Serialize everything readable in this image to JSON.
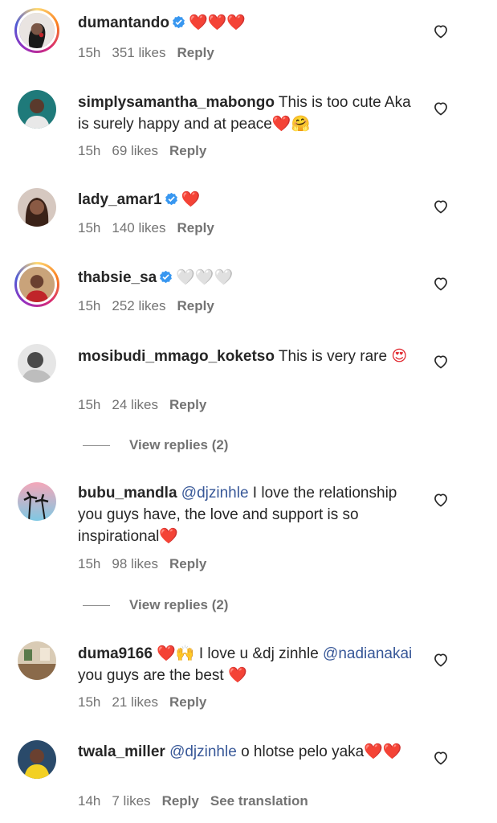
{
  "comments": [
    {
      "username": "dumantando",
      "verified": true,
      "text": "",
      "emoji": "❤️❤️❤️",
      "time": "15h",
      "likes": "351 likes",
      "reply": "Reply",
      "avatar": "dark-portrait"
    },
    {
      "username": "simplysamantha_mabongo",
      "verified": false,
      "text": "This is too cute Aka is surely happy and at peace",
      "emoji": "❤️🤗",
      "time": "15h",
      "likes": "69 likes",
      "reply": "Reply",
      "avatar": "teal-portrait"
    },
    {
      "username": "lady_amar1",
      "verified": true,
      "text": "",
      "emoji": "❤️",
      "time": "15h",
      "likes": "140 likes",
      "reply": "Reply",
      "avatar": "brown-portrait"
    },
    {
      "username": "thabsie_sa",
      "verified": true,
      "text": "",
      "emoji": "🤍🤍🤍",
      "time": "15h",
      "likes": "252 likes",
      "reply": "Reply",
      "avatar": "red-portrait"
    },
    {
      "username": "mosibudi_mmago_koketso",
      "verified": false,
      "text": "This is very rare",
      "emoji": "😍",
      "time": "15h",
      "likes": "24 likes",
      "reply": "Reply",
      "avatar": "gray-portrait"
    },
    {
      "username": "bubu_mandla",
      "verified": false,
      "mention": "@djzinhle",
      "text": "I love the relationship you guys have, the love and support is so inspirational",
      "emoji": "❤️",
      "time": "15h",
      "likes": "98 likes",
      "reply": "Reply",
      "avatar": "palm-sunset"
    },
    {
      "username": "duma9166",
      "verified": false,
      "emoji_lead": "❤️🙌",
      "text": "I love u &dj zinhle",
      "mention": "@nadianakai",
      "text2": "you guys are the best",
      "emoji": "❤️",
      "time": "15h",
      "likes": "21 likes",
      "reply": "Reply",
      "avatar": "room-photo"
    },
    {
      "username": "twala_miller",
      "verified": false,
      "mention": "@djzinhle",
      "text": "o hlotse pelo yaka",
      "emoji": "❤️❤️",
      "time": "14h",
      "likes": "7 likes",
      "reply": "Reply",
      "see_translation": "See translation",
      "avatar": "yellow-portrait"
    }
  ],
  "view_replies": [
    "View replies (2)",
    "View replies (2)"
  ],
  "colors": {
    "text": "#262626",
    "meta": "#737373",
    "mention": "#385898",
    "verified": "#3897f0",
    "heart": "#e0242b"
  }
}
